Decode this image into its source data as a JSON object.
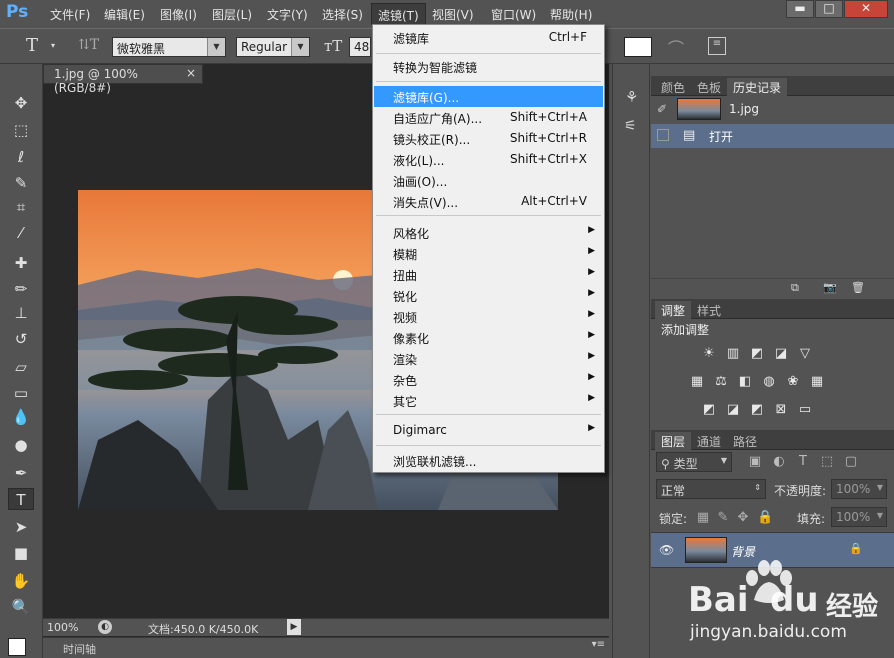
{
  "menubar": {
    "logo": "Ps",
    "items": [
      "文件(F)",
      "编辑(E)",
      "图像(I)",
      "图层(L)",
      "文字(Y)",
      "选择(S)",
      "滤镜(T)",
      "视图(V)",
      "窗口(W)",
      "帮助(H)"
    ],
    "window_buttons": [
      "▬",
      "□",
      "✕"
    ]
  },
  "options": {
    "font_family": "微软雅黑",
    "font_style": "Regular",
    "font_size": "48"
  },
  "document": {
    "tab_label": "1.jpg @ 100%(RGB/8#)",
    "tab_close": "×",
    "zoom": "100%",
    "doc_info": "文档:450.0 K/450.0K",
    "timeline_label": "时间轴"
  },
  "filter_menu": {
    "items": [
      {
        "label": "滤镜库",
        "shortcut": "Ctrl+F"
      },
      {
        "label": "转换为智能滤镜",
        "shortcut": ""
      },
      {
        "label": "滤镜库(G)...",
        "shortcut": ""
      },
      {
        "label": "自适应广角(A)...",
        "shortcut": "Shift+Ctrl+A"
      },
      {
        "label": "镜头校正(R)...",
        "shortcut": "Shift+Ctrl+R"
      },
      {
        "label": "液化(L)...",
        "shortcut": "Shift+Ctrl+X"
      },
      {
        "label": "油画(O)...",
        "shortcut": ""
      },
      {
        "label": "消失点(V)...",
        "shortcut": "Alt+Ctrl+V"
      },
      {
        "label": "风格化",
        "shortcut": ""
      },
      {
        "label": "模糊",
        "shortcut": ""
      },
      {
        "label": "扭曲",
        "shortcut": ""
      },
      {
        "label": "锐化",
        "shortcut": ""
      },
      {
        "label": "视频",
        "shortcut": ""
      },
      {
        "label": "像素化",
        "shortcut": ""
      },
      {
        "label": "渲染",
        "shortcut": ""
      },
      {
        "label": "杂色",
        "shortcut": ""
      },
      {
        "label": "其它",
        "shortcut": ""
      },
      {
        "label": "Digimarc",
        "shortcut": ""
      },
      {
        "label": "浏览联机滤镜...",
        "shortcut": ""
      }
    ],
    "submenu_arrow": "▶"
  },
  "history_panel": {
    "tabs": [
      "颜色",
      "色板",
      "历史记录"
    ],
    "snapshot_name": "1.jpg",
    "steps": [
      "打开"
    ]
  },
  "adjustments_panel": {
    "tabs": [
      "调整",
      "样式"
    ],
    "title": "添加调整"
  },
  "layers_panel": {
    "tabs": [
      "图层",
      "通道",
      "路径"
    ],
    "filter_kind": "类型",
    "blend_mode": "正常",
    "opacity_label": "不透明度:",
    "opacity_value": "100%",
    "lock_label": "锁定:",
    "fill_label": "填充:",
    "fill_value": "100%",
    "layers": [
      {
        "name": "背景"
      }
    ]
  },
  "watermark": {
    "brand": "Bai",
    "brand2": "du",
    "product": "经验",
    "url": "jingyan.baidu.com"
  },
  "colors": {
    "highlight": "#3399ff",
    "annotation_red": "#e53935",
    "panel_bg": "#535353",
    "canvas_bg": "#282828"
  }
}
